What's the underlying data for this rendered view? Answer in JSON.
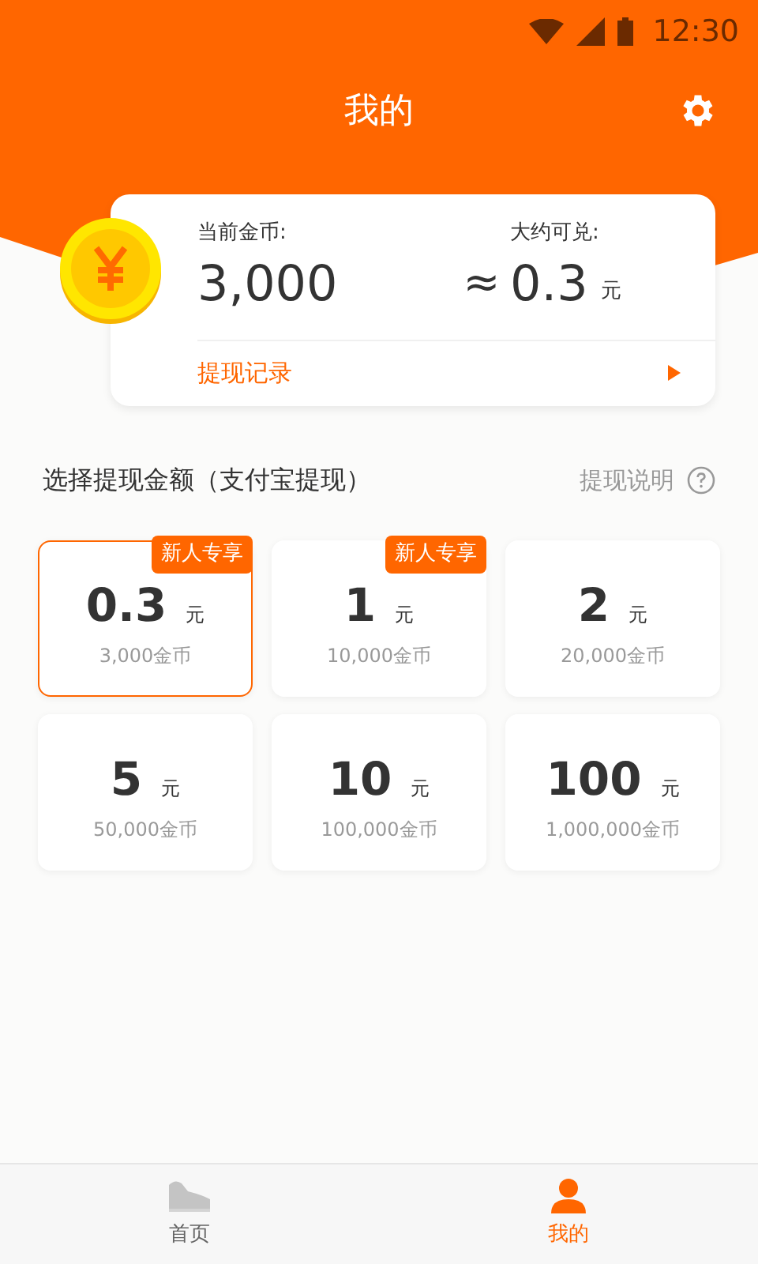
{
  "status_bar": {
    "time": "12:30"
  },
  "header": {
    "title": "我的"
  },
  "balance": {
    "coins_label": "当前金币:",
    "coins": "3,000",
    "approx": "≈",
    "value_label": "大约可兑:",
    "value": "0.3",
    "unit": "元",
    "record_link": "提现记录"
  },
  "section": {
    "title": "选择提现金额（支付宝提现）",
    "help": "提现说明"
  },
  "options": [
    {
      "amount": "0.3",
      "unit": "元",
      "coins": "3,000金币",
      "badge": "新人专享",
      "selected": true
    },
    {
      "amount": "1",
      "unit": "元",
      "coins": "10,000金币",
      "badge": "新人专享",
      "selected": false
    },
    {
      "amount": "2",
      "unit": "元",
      "coins": "20,000金币",
      "selected": false
    },
    {
      "amount": "5",
      "unit": "元",
      "coins": "50,000金币",
      "selected": false
    },
    {
      "amount": "10",
      "unit": "元",
      "coins": "100,000金币",
      "selected": false
    },
    {
      "amount": "100",
      "unit": "元",
      "coins": "1,000,000金币",
      "selected": false
    }
  ],
  "tabs": [
    {
      "label": "首页",
      "kind": "shoe",
      "selected": false
    },
    {
      "label": "我的",
      "kind": "person",
      "selected": true
    }
  ]
}
